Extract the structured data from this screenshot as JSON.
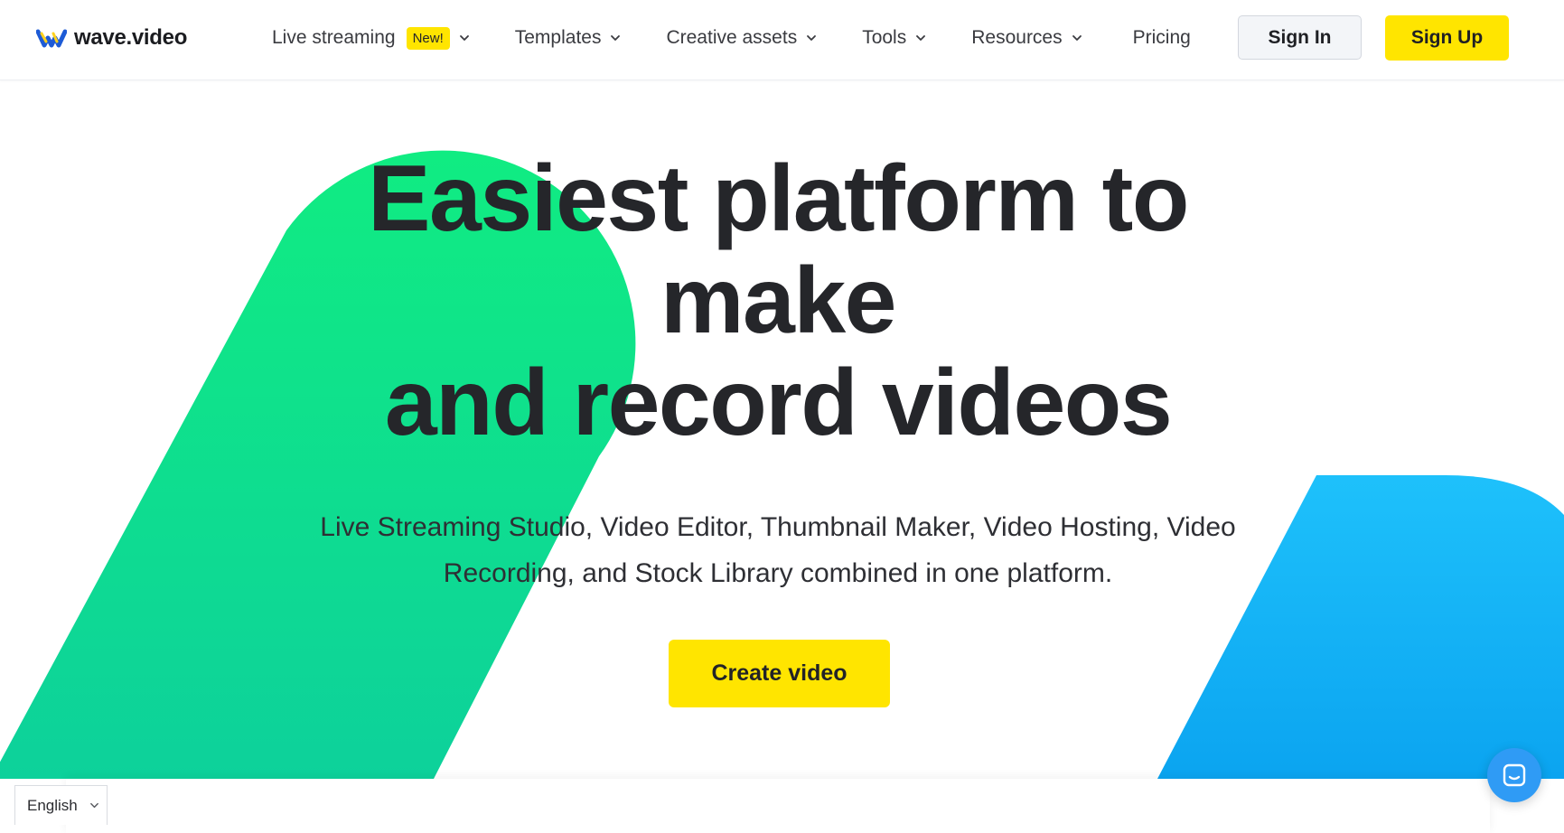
{
  "header": {
    "logo_text": "wave.video",
    "nav": [
      {
        "label": "Live streaming",
        "badge": "New!",
        "has_dropdown": true
      },
      {
        "label": "Templates",
        "has_dropdown": true
      },
      {
        "label": "Creative assets",
        "has_dropdown": true
      },
      {
        "label": "Tools",
        "has_dropdown": true
      },
      {
        "label": "Resources",
        "has_dropdown": true
      },
      {
        "label": "Pricing",
        "has_dropdown": false
      }
    ],
    "signin_label": "Sign In",
    "signup_label": "Sign Up"
  },
  "hero": {
    "title_lines": [
      "Easiest platform to",
      "make",
      "and record videos"
    ],
    "subtitle": "Live Streaming Studio, Video Editor, Thumbnail Maker, Video Hosting, Video Recording, and Stock Library combined in one platform.",
    "cta_label": "Create video"
  },
  "footer": {
    "language": "English"
  },
  "icons": {
    "logo": "wave-logo-icon",
    "dropdown": "chevron-down-icon",
    "chat": "chat-icon"
  },
  "colors": {
    "accent_yellow": "#ffe500",
    "green_shape_top": "#10ec82",
    "green_shape_bottom": "#0dd19b",
    "blue_shape_top": "#1ec1fb",
    "blue_shape_bottom": "#0ba4f0",
    "text_dark": "#25262a",
    "chat_blue": "#2f9bf5"
  }
}
